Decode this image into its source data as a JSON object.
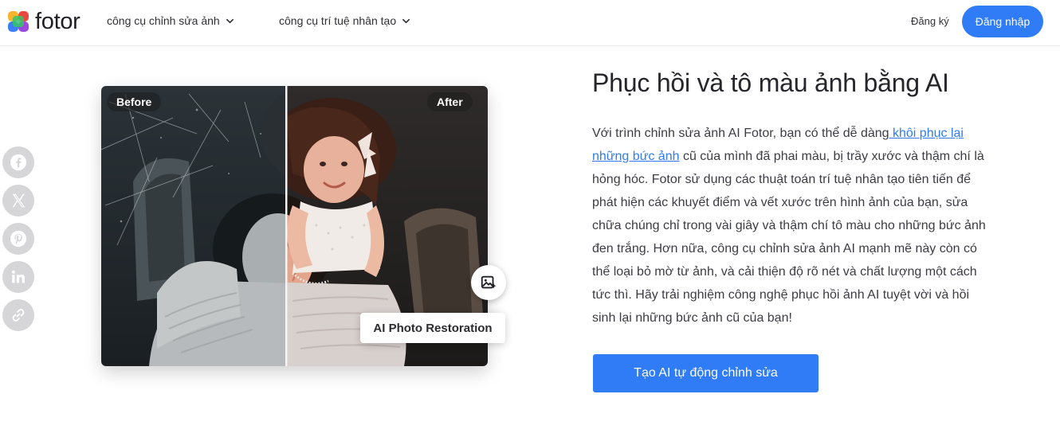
{
  "header": {
    "logo_text": "fotor",
    "nav": [
      {
        "label": "công cụ chỉnh sửa ảnh",
        "icon": "chevron-down-icon"
      },
      {
        "label": "công cụ trí tuệ nhân tạo",
        "icon": "chevron-down-icon"
      }
    ],
    "signup_label": "Đăng ký",
    "login_label": "Đăng nhập"
  },
  "share": [
    "facebook-icon",
    "x-icon",
    "pinterest-icon",
    "linkedin-icon",
    "link-icon"
  ],
  "photo": {
    "before_label": "Before",
    "after_label": "After",
    "feature_label": "AI Photo Restoration",
    "feature_icon": "image-sparkle-icon"
  },
  "content": {
    "title": "Phục hồi và tô màu ảnh bằng AI",
    "desc_before": "Với trình chỉnh sửa ảnh AI Fotor, bạn có thể dễ dàng",
    "desc_link": " khôi phục lại những bức ảnh",
    "desc_after": " cũ của mình đã phai màu, bị trầy xước và thậm chí là hỏng hóc. Fotor sử dụng các thuật toán trí tuệ nhân tạo tiên tiến để phát hiện các khuyết điểm và vết xước trên hình ảnh của bạn, sửa chữa chúng chỉ trong vài giây và thậm chí tô màu cho những bức ảnh đen trắng. Hơn nữa, công cụ chỉnh sửa ảnh AI mạnh mẽ này còn có thể loại bỏ mờ từ ảnh, và cải thiện độ rõ nét và chất lượng một cách tức thì. Hãy trải nghiệm công nghệ phục hồi ảnh AI tuyệt vời và hồi sinh lại những bức ảnh cũ của bạn!",
    "cta_label": "Tạo AI tự động chỉnh sửa"
  },
  "colors": {
    "accent": "#2f7cf6",
    "share_bg": "#d6d6d9"
  }
}
